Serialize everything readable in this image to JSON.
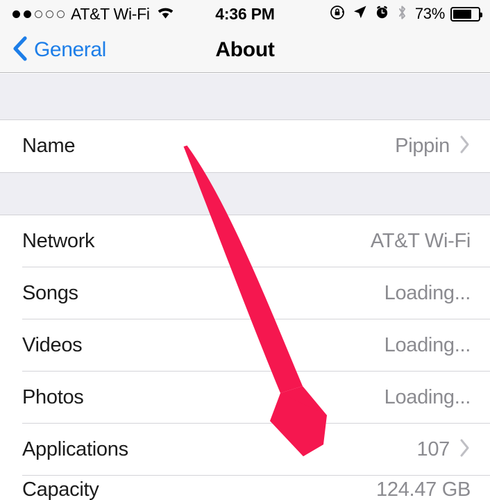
{
  "status_bar": {
    "signal_dots_filled": 2,
    "signal_dots_total": 5,
    "carrier": "AT&T Wi-Fi",
    "wifi_icon": "wifi-icon",
    "time": "4:36 PM",
    "rotation_lock_icon": "rotation-lock-icon",
    "location_icon": "location-arrow-icon",
    "alarm_icon": "alarm-clock-icon",
    "bluetooth_icon": "bluetooth-icon",
    "battery_percent": "73%",
    "battery_level": 73,
    "battery_icon": "battery-icon"
  },
  "nav_bar": {
    "back_label": "General",
    "back_icon": "chevron-left-icon",
    "title": "About"
  },
  "sections": [
    {
      "rows": [
        {
          "label": "Name",
          "value": "Pippin",
          "chevron": true
        }
      ]
    },
    {
      "rows": [
        {
          "label": "Network",
          "value": "AT&T Wi-Fi",
          "chevron": false
        },
        {
          "label": "Songs",
          "value": "Loading...",
          "chevron": false
        },
        {
          "label": "Videos",
          "value": "Loading...",
          "chevron": false
        },
        {
          "label": "Photos",
          "value": "Loading...",
          "chevron": false
        },
        {
          "label": "Applications",
          "value": "107",
          "chevron": true
        },
        {
          "label": "Capacity",
          "value": "124.47 GB",
          "chevron": false,
          "clipped": true
        }
      ]
    }
  ],
  "annotation": {
    "arrow_icon": "red-arrow-annotation",
    "color": "#f5174f"
  },
  "colors": {
    "accent_blue": "#1d7ee8",
    "value_grey": "#8b8b90",
    "group_background": "#eeeef3",
    "bar_background": "#f7f7f7",
    "annotation_pink": "#f5174f"
  }
}
